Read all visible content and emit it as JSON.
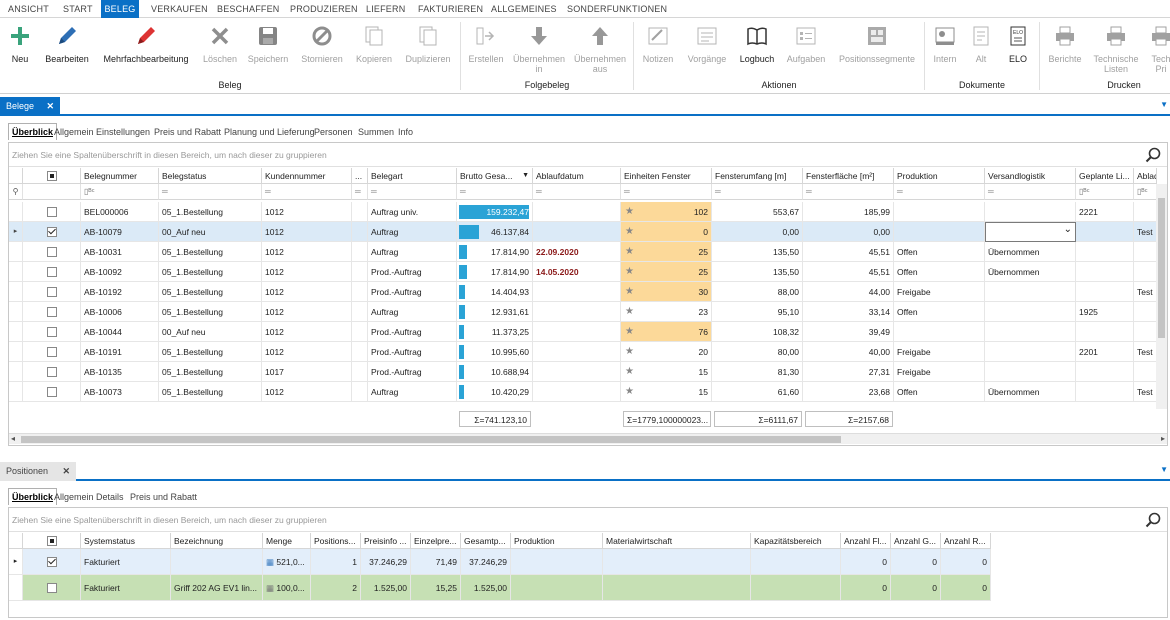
{
  "menu": [
    "ANSICHT",
    "START",
    "BELEG",
    "VERKAUFEN",
    "BESCHAFFEN",
    "PRODUZIEREN",
    "LIEFERN",
    "FAKTURIEREN",
    "ALLGEMEINES",
    "SONDERFUNKTIONEN"
  ],
  "ribbon": {
    "buttons": [
      {
        "label": "Neu",
        "icon": "plus-icon",
        "disabled": false
      },
      {
        "label": "Bearbeiten",
        "icon": "pencil-icon",
        "disabled": false
      },
      {
        "label": "Mehrfachbearbeitung",
        "icon": "red-pencil-icon",
        "disabled": false
      },
      {
        "label": "Löschen",
        "icon": "x-icon",
        "disabled": true
      },
      {
        "label": "Speichern",
        "icon": "floppy-icon",
        "disabled": true
      },
      {
        "label": "Stornieren",
        "icon": "cancel-circle-icon",
        "disabled": true
      },
      {
        "label": "Kopieren",
        "icon": "copy-icon",
        "disabled": true
      },
      {
        "label": "Duplizieren",
        "icon": "duplicate-icon",
        "disabled": true
      },
      {
        "label": "Erstellen",
        "icon": "create-icon",
        "disabled": true
      },
      {
        "label": "Übernehmen in",
        "icon": "arrow-down-icon",
        "disabled": true
      },
      {
        "label": "Übernehmen aus",
        "icon": "arrow-up-icon",
        "disabled": true
      },
      {
        "label": "Notizen",
        "icon": "notes-icon",
        "disabled": true
      },
      {
        "label": "Vorgänge",
        "icon": "processes-icon",
        "disabled": true
      },
      {
        "label": "Logbuch",
        "icon": "book-icon",
        "disabled": false
      },
      {
        "label": "Aufgaben",
        "icon": "tasks-icon",
        "disabled": true
      },
      {
        "label": "Positionssegmente",
        "icon": "segments-icon",
        "disabled": true
      },
      {
        "label": "Intern",
        "icon": "intern-icon",
        "disabled": true
      },
      {
        "label": "Alt",
        "icon": "alt-doc-icon",
        "disabled": true
      },
      {
        "label": "ELO",
        "icon": "elo-icon",
        "disabled": false
      },
      {
        "label": "Berichte",
        "icon": "printer-icon",
        "disabled": true
      },
      {
        "label": "Technische Listen",
        "icon": "printer-icon",
        "disabled": true
      },
      {
        "label": "Tech Pri",
        "icon": "printer-icon",
        "disabled": true
      }
    ],
    "groups": [
      "Beleg",
      "Folgebeleg",
      "Aktionen",
      "Dokumente",
      "Drucken"
    ]
  },
  "belege": {
    "tab": "Belege",
    "subtabs": [
      "Überblick",
      "Allgemein",
      "Einstellungen",
      "Preis und Rabatt",
      "Planung und Lieferung",
      "Personen",
      "Summen",
      "Info"
    ],
    "grouphint": "Ziehen Sie eine Spaltenüberschrift in diesen Bereich, um nach dieser zu gruppieren",
    "columns": [
      "Belegnummer",
      "Belegstatus",
      "Kundennummer",
      "...",
      "Belegart",
      "Brutto Gesa...",
      "Ablaufdatum",
      "Einheiten Fenster",
      "Fensterumfang [m]",
      "Fensterfläche [m²]",
      "Produktion",
      "Versandlogistik",
      "Geplante Li...",
      "Ablades"
    ],
    "rows": [
      {
        "nr": "BEL000006",
        "status": "05_1.Bestellung",
        "kunde": "1012",
        "art": "Auftrag univ.",
        "brutto": "159.232,47",
        "bar": 1.0,
        "ablauf": "",
        "einheiten": "102",
        "hl": true,
        "umfang": "553,67",
        "flaeche": "185,99",
        "prod": "",
        "versand": "",
        "geplant": "2221",
        "ablade": "",
        "checked": false,
        "selected": false
      },
      {
        "nr": "AB-10079",
        "status": "00_Auf neu",
        "kunde": "1012",
        "art": "Auftrag",
        "brutto": "46.137,84",
        "bar": 0.29,
        "ablauf": "",
        "einheiten": "0",
        "hl": true,
        "umfang": "0,00",
        "flaeche": "0,00",
        "prod": "",
        "versand": "",
        "geplant": "",
        "ablade": "Test",
        "checked": true,
        "selected": true
      },
      {
        "nr": "AB-10031",
        "status": "05_1.Bestellung",
        "kunde": "1012",
        "art": "Auftrag",
        "brutto": "17.814,90",
        "bar": 0.11,
        "ablauf": "22.09.2020",
        "einheiten": "25",
        "hl": true,
        "umfang": "135,50",
        "flaeche": "45,51",
        "prod": "Offen",
        "versand": "Übernommen",
        "geplant": "",
        "ablade": "",
        "checked": false,
        "selected": false
      },
      {
        "nr": "AB-10092",
        "status": "05_1.Bestellung",
        "kunde": "1012",
        "art": "Prod.-Auftrag",
        "brutto": "17.814,90",
        "bar": 0.11,
        "ablauf": "14.05.2020",
        "einheiten": "25",
        "hl": true,
        "umfang": "135,50",
        "flaeche": "45,51",
        "prod": "Offen",
        "versand": "Übernommen",
        "geplant": "",
        "ablade": "",
        "checked": false,
        "selected": false
      },
      {
        "nr": "AB-10192",
        "status": "05_1.Bestellung",
        "kunde": "1012",
        "art": "Prod.-Auftrag",
        "brutto": "14.404,93",
        "bar": 0.09,
        "ablauf": "",
        "einheiten": "30",
        "hl": true,
        "umfang": "88,00",
        "flaeche": "44,00",
        "prod": "Freigabe",
        "versand": "",
        "geplant": "",
        "ablade": "Test",
        "checked": false,
        "selected": false
      },
      {
        "nr": "AB-10006",
        "status": "05_1.Bestellung",
        "kunde": "1012",
        "art": "Auftrag",
        "brutto": "12.931,61",
        "bar": 0.08,
        "ablauf": "",
        "einheiten": "23",
        "hl": false,
        "umfang": "95,10",
        "flaeche": "33,14",
        "prod": "Offen",
        "versand": "",
        "geplant": "1925",
        "ablade": "",
        "checked": false,
        "selected": false
      },
      {
        "nr": "AB-10044",
        "status": "00_Auf neu",
        "kunde": "1012",
        "art": "Prod.-Auftrag",
        "brutto": "11.373,25",
        "bar": 0.07,
        "ablauf": "",
        "einheiten": "76",
        "hl": true,
        "umfang": "108,32",
        "flaeche": "39,49",
        "prod": "",
        "versand": "",
        "geplant": "",
        "ablade": "",
        "checked": false,
        "selected": false
      },
      {
        "nr": "AB-10191",
        "status": "05_1.Bestellung",
        "kunde": "1012",
        "art": "Prod.-Auftrag",
        "brutto": "10.995,60",
        "bar": 0.07,
        "ablauf": "",
        "einheiten": "20",
        "hl": false,
        "umfang": "80,00",
        "flaeche": "40,00",
        "prod": "Freigabe",
        "versand": "",
        "geplant": "2201",
        "ablade": "Test",
        "checked": false,
        "selected": false
      },
      {
        "nr": "AB-10135",
        "status": "05_1.Bestellung",
        "kunde": "1017",
        "art": "Prod.-Auftrag",
        "brutto": "10.688,94",
        "bar": 0.07,
        "ablauf": "",
        "einheiten": "15",
        "hl": false,
        "umfang": "81,30",
        "flaeche": "27,31",
        "prod": "Freigabe",
        "versand": "",
        "geplant": "",
        "ablade": "",
        "checked": false,
        "selected": false
      },
      {
        "nr": "AB-10073",
        "status": "05_1.Bestellung",
        "kunde": "1012",
        "art": "Auftrag",
        "brutto": "10.420,29",
        "bar": 0.07,
        "ablauf": "",
        "einheiten": "15",
        "hl": false,
        "umfang": "61,60",
        "flaeche": "23,68",
        "prod": "Offen",
        "versand": "Übernommen",
        "geplant": "",
        "ablade": "Test",
        "checked": false,
        "selected": false
      }
    ],
    "sums": {
      "brutto": "Σ=741.123,10",
      "einheiten": "Σ=1779,100000023...",
      "umfang": "Σ=6111,67",
      "flaeche": "Σ=2157,68"
    }
  },
  "positionen": {
    "tab": "Positionen",
    "subtabs": [
      "Überblick",
      "Allgemein",
      "Details",
      "Preis und Rabatt"
    ],
    "grouphint": "Ziehen Sie eine Spaltenüberschrift in diesen Bereich, um nach dieser zu gruppieren",
    "columns": [
      "Systemstatus",
      "Bezeichnung",
      "Menge",
      "Positions...",
      "Preisinfo ...",
      "Einzelpre...",
      "Gesamtp...",
      "Produktion",
      "Materialwirtschaft",
      "Kapazitätsbereich",
      "Anzahl Fl...",
      "Anzahl G...",
      "Anzahl R..."
    ],
    "rows": [
      {
        "status": "Fakturiert",
        "bez": "",
        "menge": "521,0...",
        "pos": "1",
        "preisinfo": "37.246,29",
        "einzel": "71,49",
        "gesamt": "37.246,29",
        "a1": "0",
        "a2": "0",
        "a3": "0",
        "checked": true,
        "green": false
      },
      {
        "status": "Fakturiert",
        "bez": "Griff 202 AG EV1 lin...",
        "menge": "100,0...",
        "pos": "2",
        "preisinfo": "1.525,00",
        "einzel": "15,25",
        "gesamt": "1.525,00",
        "a1": "0",
        "a2": "0",
        "a3": "0",
        "checked": false,
        "green": true
      }
    ]
  }
}
